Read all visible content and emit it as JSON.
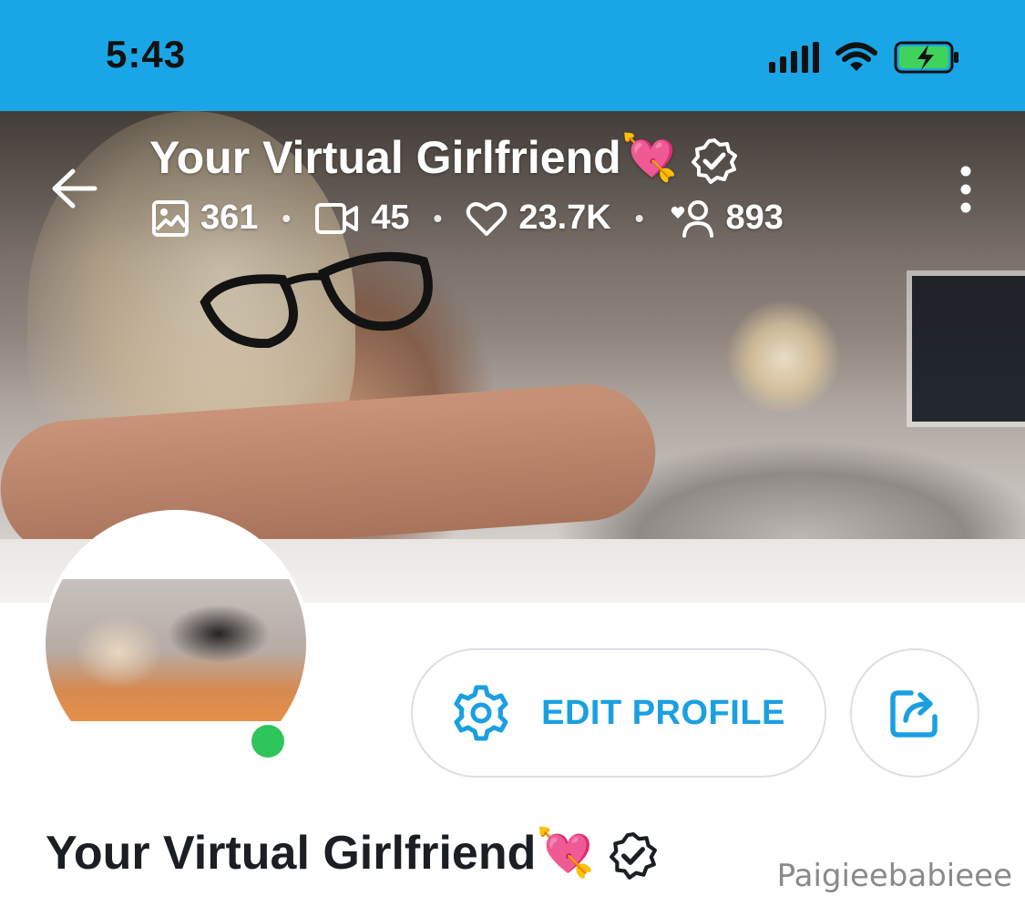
{
  "status_bar": {
    "time": "5:43",
    "signal_icon": "signal-bars-icon",
    "wifi_icon": "wifi-icon",
    "battery_icon": "battery-charging-icon",
    "background_color": "#1aa6e6",
    "battery_color": "#3fd35c"
  },
  "header": {
    "back_icon": "arrow-left-icon",
    "title": "Your Virtual Girlfriend",
    "title_emoji": "💘",
    "verified_icon": "verified-badge-icon",
    "more_icon": "vertical-dots-icon",
    "stats": {
      "photos": "361",
      "videos": "45",
      "likes": "23.7K",
      "fans": "893"
    },
    "separator": "•"
  },
  "avatar": {
    "online": true,
    "online_color": "#2ec55a"
  },
  "actions": {
    "edit_profile_label": "EDIT PROFILE",
    "edit_icon": "gear-icon",
    "share_icon": "share-icon",
    "accent_color": "#1aa0e2"
  },
  "profile": {
    "name": "Your Virtual Girlfriend",
    "name_emoji": "💘"
  },
  "watermark": "Paigieebabieee"
}
